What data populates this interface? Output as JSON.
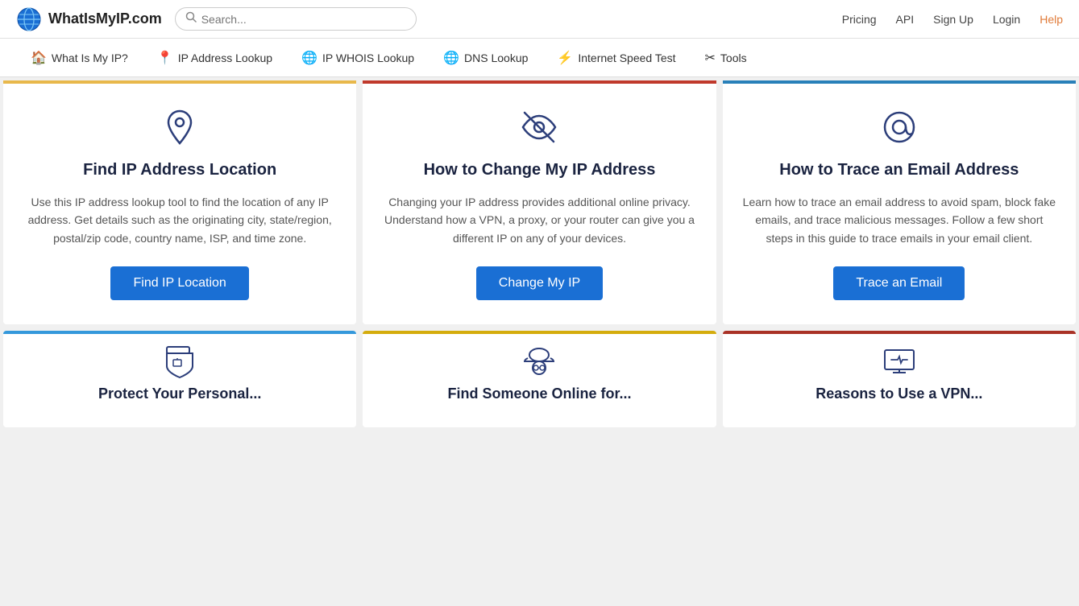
{
  "site": {
    "logo_text": "WhatIsMyIP.com",
    "search_placeholder": "Search..."
  },
  "top_nav": {
    "links": [
      {
        "label": "Pricing",
        "id": "pricing"
      },
      {
        "label": "API",
        "id": "api"
      },
      {
        "label": "Sign Up",
        "id": "signup"
      },
      {
        "label": "Login",
        "id": "login"
      },
      {
        "label": "Help",
        "id": "help",
        "accent": true
      }
    ]
  },
  "second_nav": {
    "items": [
      {
        "label": "What Is My IP?",
        "icon": "🏠",
        "id": "what-is-my-ip"
      },
      {
        "label": "IP Address Lookup",
        "icon": "📍",
        "id": "ip-address-lookup"
      },
      {
        "label": "IP WHOIS Lookup",
        "icon": "🌐",
        "id": "ip-whois-lookup"
      },
      {
        "label": "DNS Lookup",
        "icon": "🌐",
        "id": "dns-lookup"
      },
      {
        "label": "Internet Speed Test",
        "icon": "⚡",
        "id": "speed-test"
      },
      {
        "label": "Tools",
        "icon": "🔧",
        "id": "tools"
      }
    ]
  },
  "cards": [
    {
      "id": "find-ip-location",
      "border_color": "#e8b84b",
      "title": "Find IP Address Location",
      "description": "Use this IP address lookup tool to find the location of any IP address. Get details such as the originating city, state/region, postal/zip code, country name, ISP, and time zone.",
      "button_label": "Find IP Location",
      "icon_type": "location"
    },
    {
      "id": "change-my-ip",
      "border_color": "#c0392b",
      "title": "How to Change My IP Address",
      "description": "Changing your IP address provides additional online privacy. Understand how a VPN, a proxy, or your router can give you a different IP on any of your devices.",
      "button_label": "Change My IP",
      "icon_type": "eye-slash"
    },
    {
      "id": "trace-email",
      "border_color": "#2980b9",
      "title": "How to Trace an Email Address",
      "description": "Learn how to trace an email address to avoid spam, block fake emails, and trace malicious messages. Follow a few short steps in this guide to trace emails in your email client.",
      "button_label": "Trace an Email",
      "icon_type": "at-sign"
    }
  ],
  "bottom_cards": [
    {
      "id": "protect-personal",
      "border_color": "#3498db",
      "title": "Protect Your Personal...",
      "icon_type": "shield"
    },
    {
      "id": "find-someone",
      "border_color": "#d4ac0d",
      "title": "Find Someone Online for...",
      "icon_type": "spy"
    },
    {
      "id": "reasons-vpn",
      "border_color": "#a93226",
      "title": "Reasons to Use a VPN...",
      "icon_type": "vpn"
    }
  ]
}
